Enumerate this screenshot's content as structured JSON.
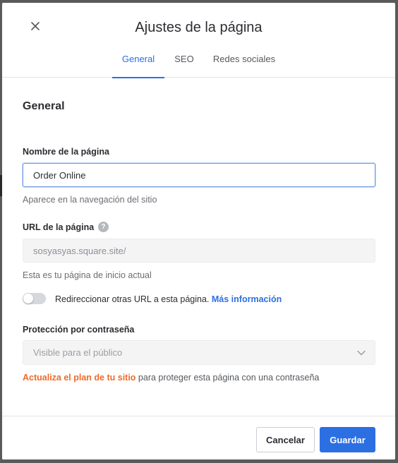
{
  "dialog": {
    "title": "Ajustes de la página",
    "close_icon": "close-icon"
  },
  "tabs": [
    {
      "label": "General",
      "active": true
    },
    {
      "label": "SEO",
      "active": false
    },
    {
      "label": "Redes sociales",
      "active": false
    }
  ],
  "section": {
    "title": "General"
  },
  "page_name": {
    "label": "Nombre de la página",
    "value": "Order Online",
    "hint": "Aparece en la navegación del sitio"
  },
  "page_url": {
    "label": "URL de la página",
    "help_icon": "?",
    "value": "sosyasyas.square.site/",
    "hint": "Esta es tu página de inicio actual"
  },
  "redirect": {
    "enabled": false,
    "text": "Redireccionar otras URL a esta página.",
    "link": "Más información"
  },
  "password": {
    "label": "Protección por contraseña",
    "selected": "Visible para el público",
    "upgrade_link": "Actualiza el plan de tu sitio",
    "upgrade_text": " para proteger esta página con una contraseña"
  },
  "footer": {
    "cancel_label": "Cancelar",
    "save_label": "Guardar"
  },
  "colors": {
    "accent": "#2b6fe3",
    "warning_link": "#ef6a2a"
  }
}
